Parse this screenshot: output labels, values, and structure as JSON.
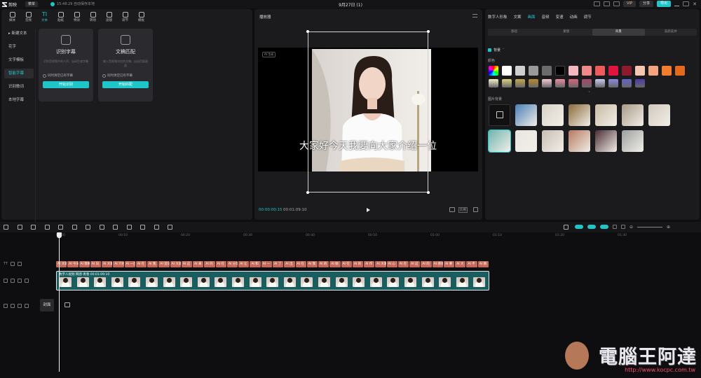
{
  "app": {
    "name": "剪映",
    "menu_label": "菜单",
    "save_status": "15:48:29 自动保存本地",
    "title": "9月27日 (1)"
  },
  "top_right": {
    "pro_label": "VIP",
    "share_label": "分享",
    "export_label": "导出"
  },
  "toolbar": [
    {
      "label": "媒体",
      "icon": "media-icon"
    },
    {
      "label": "音频",
      "icon": "audio-icon"
    },
    {
      "label": "文本",
      "icon": "text-icon",
      "active": true
    },
    {
      "label": "贴纸",
      "icon": "sticker-icon"
    },
    {
      "label": "特效",
      "icon": "effects-icon"
    },
    {
      "label": "转场",
      "icon": "transition-icon"
    },
    {
      "label": "滤镜",
      "icon": "filter-icon"
    },
    {
      "label": "调节",
      "icon": "adjust-icon"
    },
    {
      "label": "模板",
      "icon": "template-icon"
    }
  ],
  "text_sidebar": [
    "新建文本",
    "花字",
    "文字模板",
    "智能字幕",
    "识别歌词",
    "本地字幕"
  ],
  "text_sidebar_active": 3,
  "cards": [
    {
      "title": "识别字幕",
      "desc": "识别音视频中的人声，自动生成字幕",
      "option": "同时清空已有字幕",
      "button": "开始识别"
    },
    {
      "title": "文稿匹配",
      "desc": "输入音视频对应的文稿，自动匹配画面",
      "option": "同时清空已有字幕",
      "button": "开始匹配"
    }
  ],
  "player": {
    "title": "播放器",
    "subtitle": "大家好今天我要向大家介绍一位",
    "ai_tag": "AI 生成",
    "current_time": "00:00:00:15",
    "total_time": "00:01:09:10",
    "ratio": "比例"
  },
  "inspector": {
    "tabs": [
      "数字人形象",
      "文案",
      "画面",
      "音频",
      "变速",
      "动画",
      "调节"
    ],
    "active_tab": 2,
    "subtabs": [
      "基础",
      "蒙版",
      "背景",
      "美颜美体"
    ],
    "active_subtab": 2,
    "bg_toggle": "背景",
    "color_label": "颜色",
    "image_label": "图片背景",
    "colors_row1": [
      "#ffffff",
      "#d0d0d0",
      "#9a9a9a",
      "#6b6b6b",
      "#000000",
      "#f5b8c0",
      "#f08a8a",
      "#ef5b5b",
      "#e0143c",
      "#8e1a2e",
      "#f5c7b3",
      "#f4a57e",
      "#f07e2e",
      "#e26a1a"
    ],
    "colors_row2": [
      "#f3f0c4",
      "#dcd07a",
      "#c6a84a",
      "#b98a2a",
      "#f4c8d2",
      "#e88aa0",
      "#d9647a",
      "#a8456a",
      "#c8c8f0",
      "#8a8ae0",
      "#6262cc",
      "#4a3aa8"
    ]
  },
  "timeline": {
    "ruler": [
      "00:00",
      "00:10",
      "00:20",
      "00:30",
      "00:40",
      "00:50",
      "01:00",
      "01:10",
      "01:20",
      "01:30"
    ],
    "subtitle_clips": [
      "AI 大家",
      "AI 今天",
      "AI 我要",
      "AI 向",
      "AI 大家",
      "AI 介绍",
      "AI 一位",
      "AI 在",
      "AI 我",
      "AI 近日",
      "AI 大家",
      "AI 这",
      "AI 来",
      "AI 的",
      "AI 在",
      "AI 分享",
      "AI 让",
      "AI 和",
      "AI 一",
      "AI 了",
      "AI 出",
      "AI 在",
      "AI 我",
      "AI 的",
      "AI 她",
      "AI 在",
      "AI 的",
      "AI 作",
      "AI 大家",
      "AI 心",
      "AI 在",
      "AI 这",
      "AI 的",
      "AI 感谢",
      "AI 要",
      "AI 大",
      "AI 不",
      "AI 精"
    ],
    "video_label": "数字人视频  网感·青春  00:01:09:10",
    "cover_label": "封面"
  },
  "watermark": {
    "text": "電腦王阿達",
    "url": "http://www.kocpc.com.tw"
  }
}
